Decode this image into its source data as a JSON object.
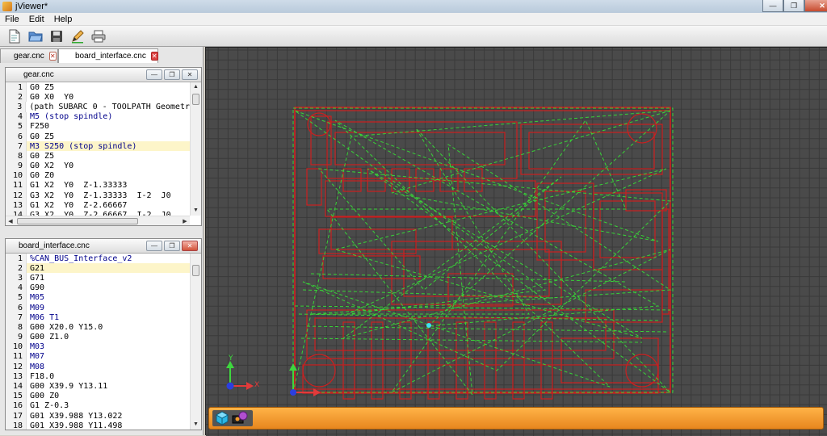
{
  "window": {
    "title": "jViewer*"
  },
  "menu": {
    "items": [
      "File",
      "Edit",
      "Help"
    ]
  },
  "toolbar": {
    "buttons": [
      "new-file-icon",
      "open-folder-icon",
      "save-icon",
      "edit-icon",
      "print-icon"
    ]
  },
  "tabs": [
    {
      "label": "gear.cnc",
      "active": false
    },
    {
      "label": "board_interface.cnc",
      "active": true
    }
  ],
  "editors": {
    "gear": {
      "title": "gear.cnc",
      "lines": [
        "G0 Z5",
        "G0 X0  Y0",
        "(path SUBARC 0 - TOOLPATH Geometr",
        "M5 (stop spindle)",
        "F250",
        "G0 Z5",
        "M3 S250 (stop spindle)",
        "G0 Z5",
        "G0 X2  Y0",
        "G0 Z0",
        "G1 X2  Y0  Z-1.33333",
        "G3 X2  Y0  Z-1.33333  I-2  J0",
        "G1 X2  Y0  Z-2.66667",
        "G3 X2  Y0  Z-2.66667  I-2  J0"
      ],
      "highlight_line": 7
    },
    "board": {
      "title": "board_interface.cnc",
      "lines": [
        "%CAN_BUS_Interface_v2",
        "G21",
        "G71",
        "G90",
        "M05",
        "M09",
        "M06 T1",
        "G00 X20.0 Y15.0",
        "G00 Z1.0",
        "M03",
        "M07",
        "M08",
        "F18.0",
        "G00 X39.9 Y13.11",
        "G00 Z0",
        "G1 Z-0.3",
        "G01 X39.988 Y13.022",
        "G01 X39.988 Y11.498"
      ],
      "highlight_line": 2
    }
  },
  "axes": {
    "x_label": "X",
    "y_label": "Y"
  },
  "colors": {
    "grid_bg": "#4a4a4a",
    "grid_line": "#3a3a3a",
    "toolpath_cut": "#cc1f1f",
    "toolpath_rapid": "#37d437",
    "accent_orange": "#f39a2c",
    "editor_highlight": "#fdf5c9"
  },
  "bottombar": {
    "icons": [
      "cube-view-icon",
      "camera-view-icon"
    ]
  }
}
